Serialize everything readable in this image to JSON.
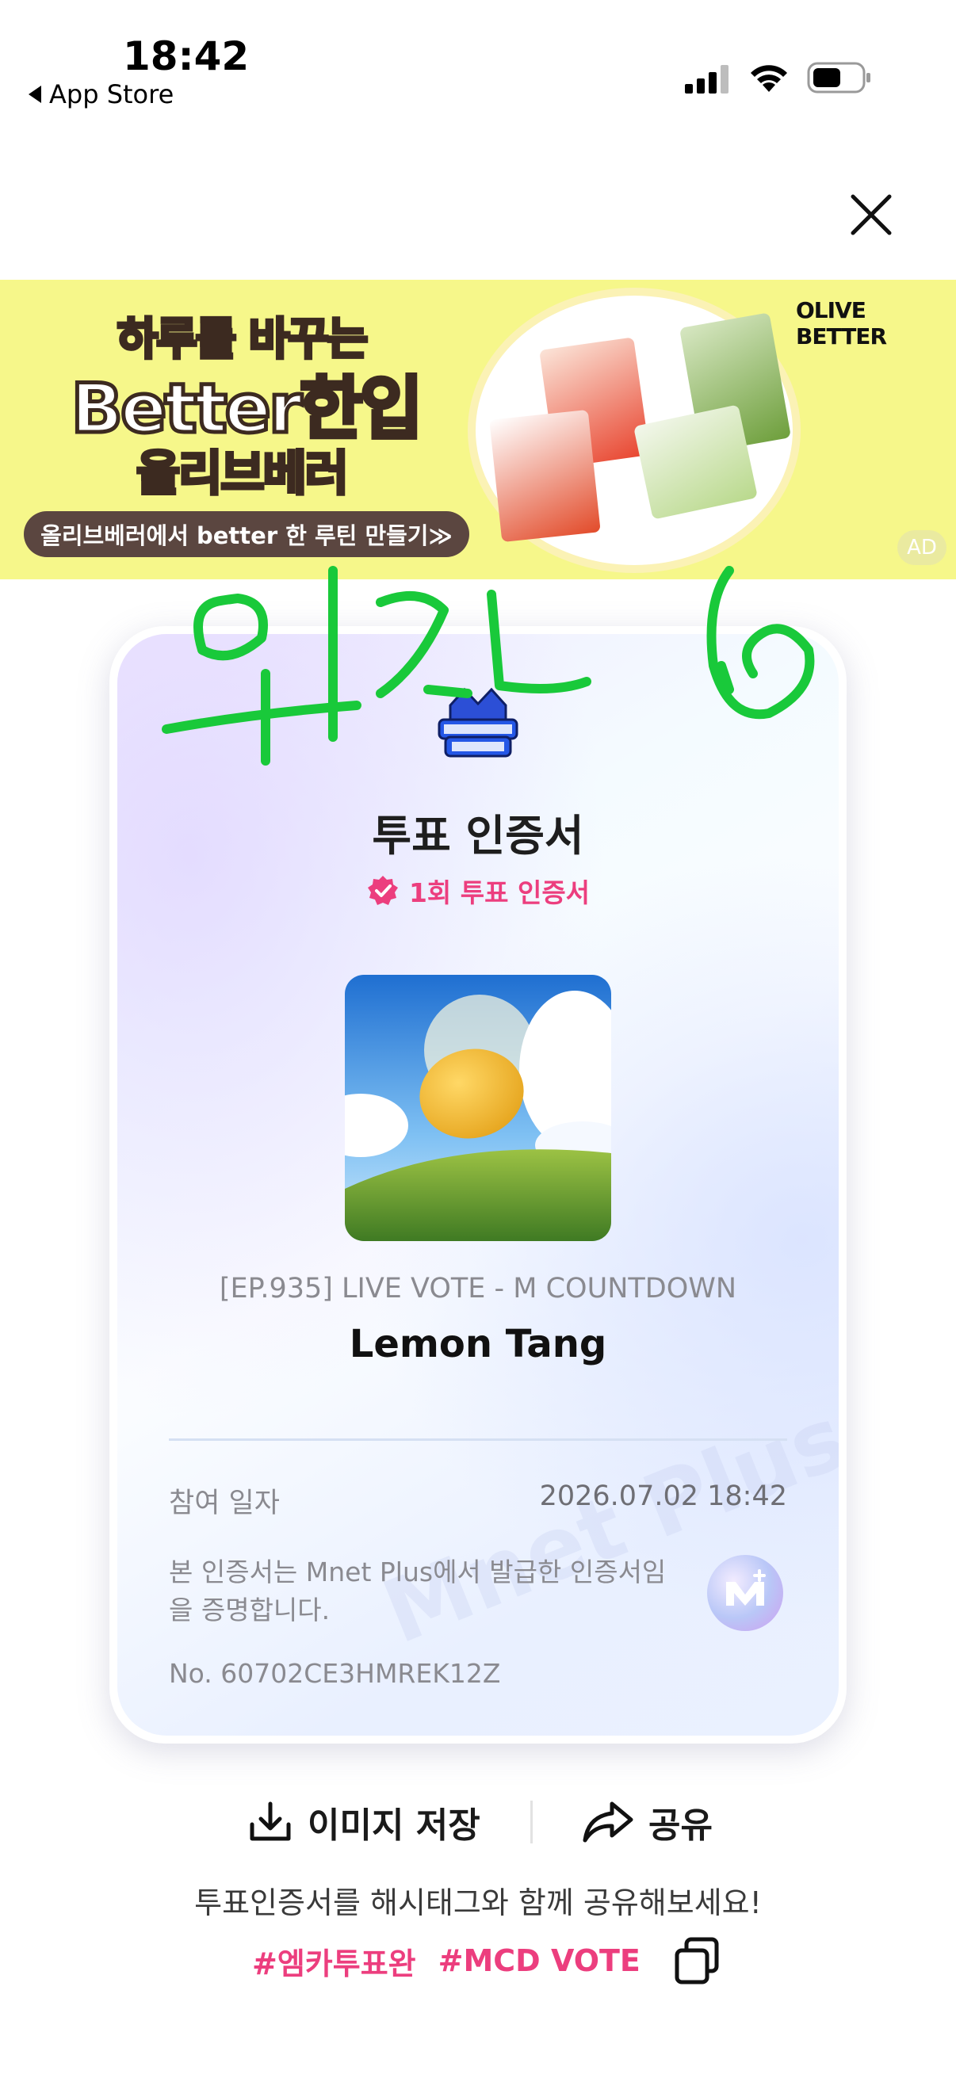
{
  "status_bar": {
    "time": "18:42",
    "back_app": "App Store",
    "signal_icon": "cellular-signal-icon",
    "wifi_icon": "wifi-icon",
    "battery_icon": "battery-icon"
  },
  "close_icon": "close-icon",
  "ad": {
    "line1": "하루를 바꾸는",
    "line2": "Better한입",
    "line3": "올리브베러",
    "cta": "올리브베러에서 better 한 루틴 만들기≫",
    "brand": "OLIVE BETTER",
    "badge": "AD",
    "background_color": "#f6f78a"
  },
  "certificate": {
    "logo": "m-countdown-logo",
    "title": "투표 인증서",
    "badge_text": "1회 투표 인증서",
    "accent_color": "#ec3e7e",
    "episode": "[EP.935] LIVE VOTE - M COUNTDOWN",
    "song": "Lemon Tang",
    "date_label": "참여 일자",
    "date_value": "2026.07.02 18:42",
    "notice": "본 인증서는 Mnet Plus에서 발급한 인증서임을 증명합니다.",
    "number": "No. 60702CE3HMREK12Z",
    "watermark": "Mnet Plus"
  },
  "handwriting": {
    "text": "위고나",
    "color": "#19c93a"
  },
  "actions": {
    "save_label": "이미지 저장",
    "share_label": "공유",
    "hint": "투표인증서를 해시태그와 함께 공유해보세요!",
    "hashtags": [
      "#엠카투표완",
      "#MCD VOTE"
    ]
  }
}
